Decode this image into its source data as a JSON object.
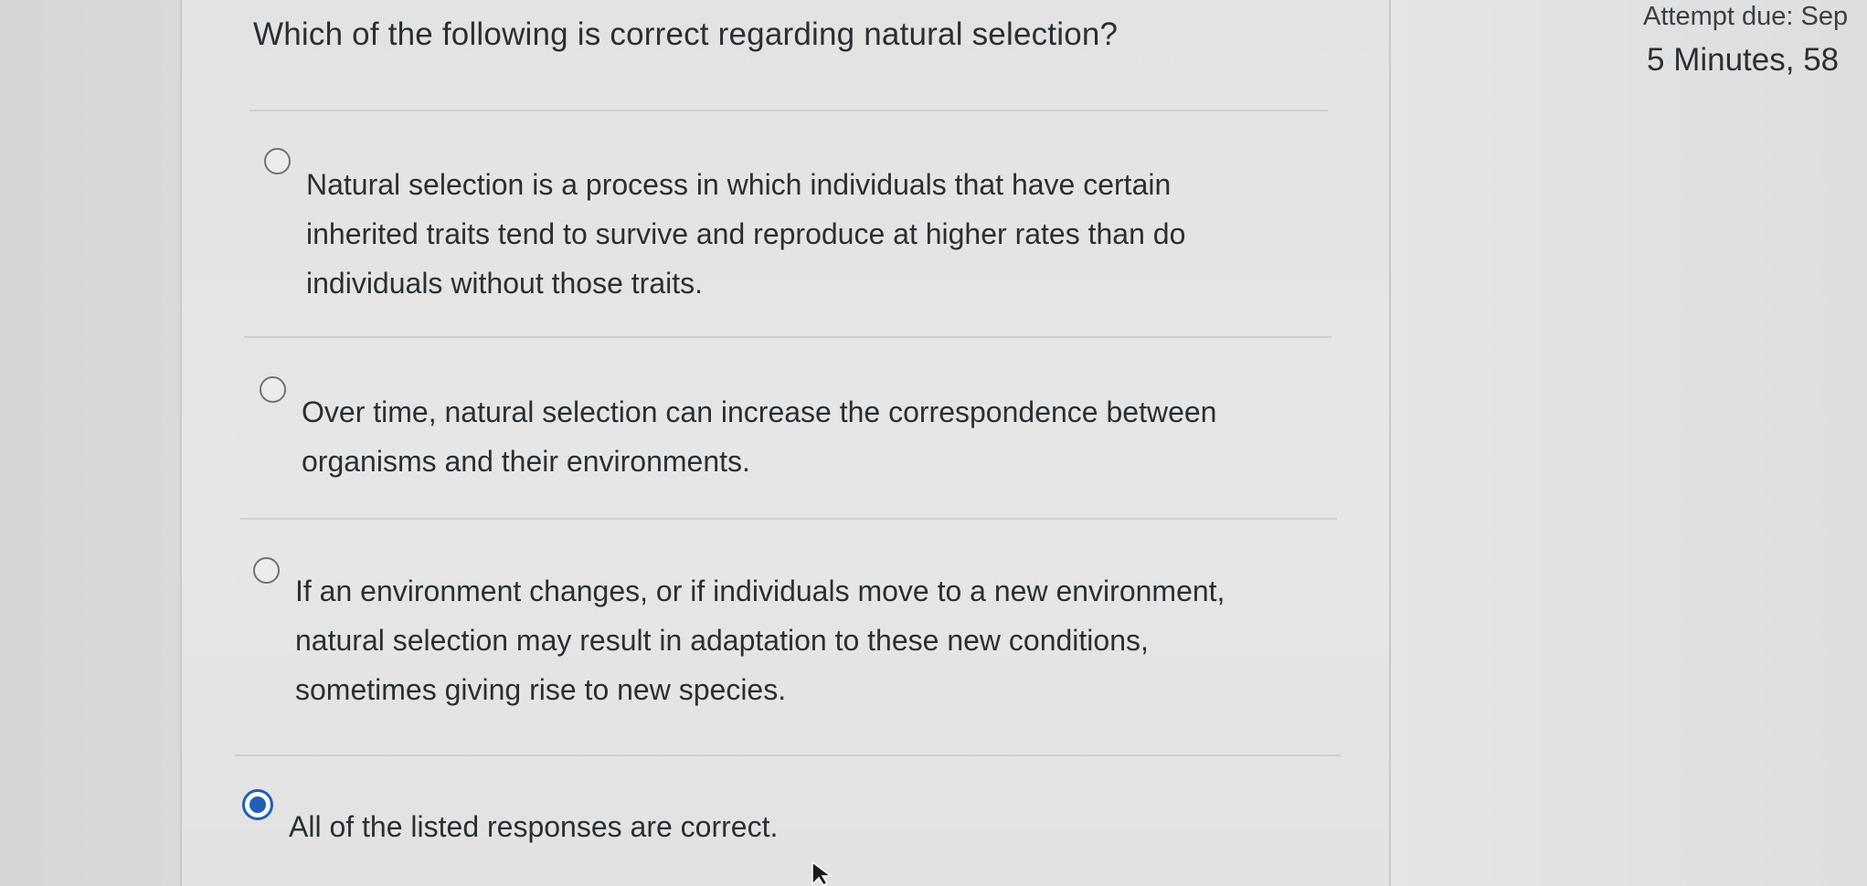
{
  "question": {
    "text": "Which of the following is correct regarding natural selection?"
  },
  "answers": [
    {
      "lines": [
        "Natural selection is a process in which individuals that have certain",
        "inherited traits tend to survive and reproduce at higher rates than do",
        "individuals without those traits."
      ],
      "selected": false
    },
    {
      "lines": [
        "Over time, natural selection can increase the correspondence between",
        "organisms and their environments."
      ],
      "selected": false
    },
    {
      "lines": [
        "If an environment changes, or if individuals move to a new environment,",
        "natural selection may result in adaptation to these new conditions,",
        "sometimes giving rise to new species."
      ],
      "selected": false
    },
    {
      "lines": [
        "All of the listed responses are correct."
      ],
      "selected": true
    }
  ],
  "sidebar": {
    "attempt_due": "Attempt due: Sep",
    "time_remaining": "5 Minutes, 58"
  },
  "colors": {
    "accent": "#1f5fb8"
  }
}
